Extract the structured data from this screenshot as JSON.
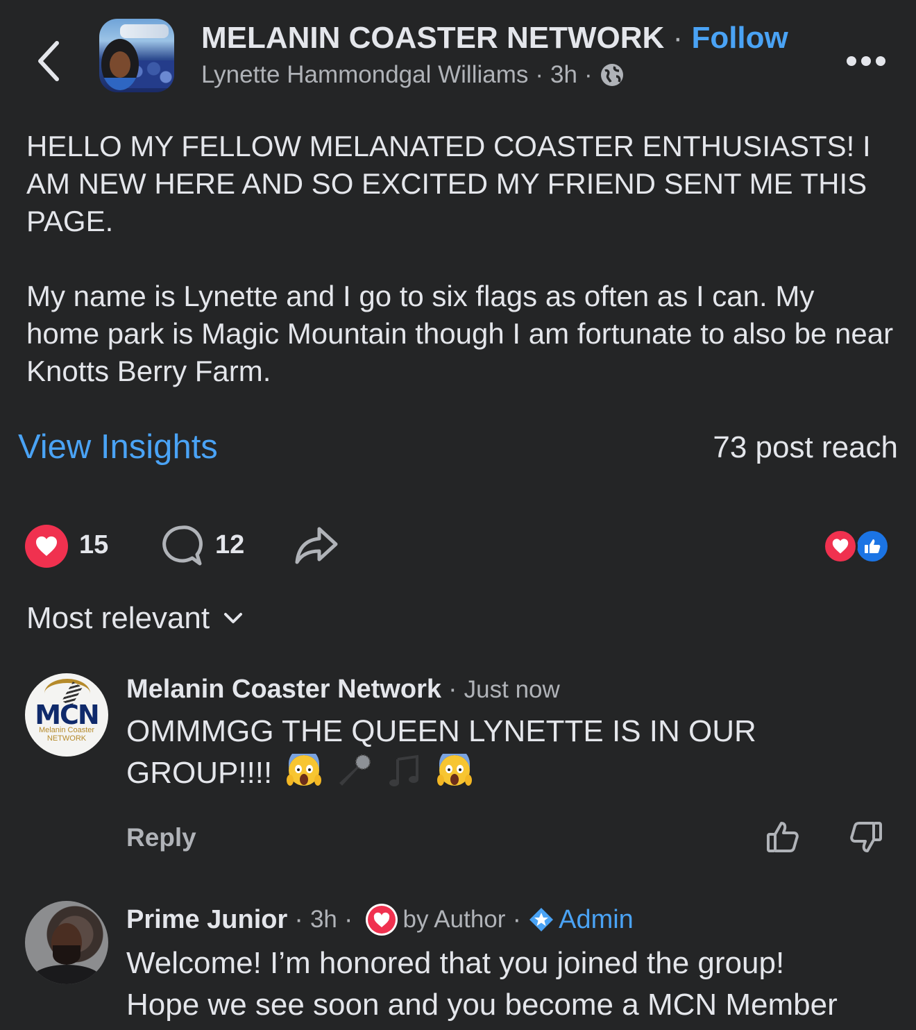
{
  "header": {
    "group_name": "MELANIN COASTER NETWORK",
    "separator": "·",
    "follow_label": "Follow",
    "author": "Lynette Hammondgal Williams",
    "time": "3h",
    "dot": "·",
    "privacy_icon": "globe-icon"
  },
  "post": {
    "paragraph1": "HELLO MY FELLOW MELANATED COASTER ENTHUSIASTS! I AM NEW HERE AND SO EXCITED MY FRIEND SENT ME THIS PAGE.",
    "paragraph2": "My name is Lynette and I go to six flags as often as I can. My home park is Magic Mountain though I am fortunate to also be near Knotts Berry Farm."
  },
  "insights": {
    "view_label": "View Insights",
    "reach_text": "73 post reach"
  },
  "actions": {
    "reaction_count": "15",
    "comment_count": "12"
  },
  "comments_section": {
    "sort_label": "Most relevant"
  },
  "comments": [
    {
      "author": "Melanin Coaster Network",
      "time": "Just now",
      "text": "OMMMGG THE QUEEN LYNETTE IS IN OUR GROUP!!!!",
      "reply_label": "Reply",
      "avatar_logo": "MCN",
      "avatar_sub": "Melanin Coaster NETWORK",
      "emojis": [
        "screaming-face",
        "microphone",
        "music-notes",
        "screaming-face"
      ]
    },
    {
      "author": "Prime Junior",
      "time": "3h",
      "author_badge": "by Author",
      "role": "Admin",
      "text_line1": "Welcome! I’m honored that you joined the group!",
      "text_line2": "Hope we see soon and you become a MCN Member"
    }
  ],
  "colors": {
    "background": "#242526",
    "link": "#4aa3f5",
    "heart": "#f0314f",
    "like": "#1b74e4"
  }
}
